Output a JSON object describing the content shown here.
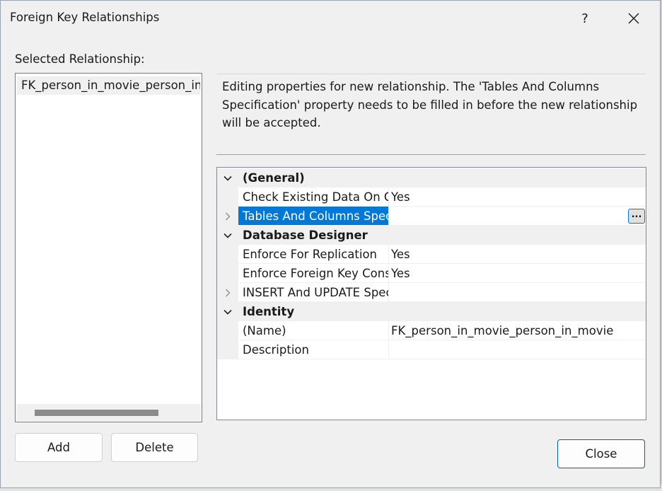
{
  "dialog": {
    "title": "Foreign Key Relationships",
    "help_label": "?",
    "close_icon": "close-x-icon"
  },
  "selected_relationship": {
    "label": "Selected Relationship:",
    "items": [
      "FK_person_in_movie_person_in_movie"
    ]
  },
  "description": "Editing properties for new relationship.  The 'Tables And Columns Specification' property needs to be filled in before the new relationship will be accepted.",
  "property_grid": {
    "categories": [
      {
        "name": "(General)",
        "expanded": true,
        "rows": [
          {
            "name": "Check Existing Data On Creation Or Re-Enabling",
            "value": "Yes",
            "expandable": false
          },
          {
            "name": "Tables And Columns Specification",
            "value": "",
            "expandable": true,
            "selected": true,
            "ellipsis": "..."
          }
        ]
      },
      {
        "name": "Database Designer",
        "expanded": true,
        "rows": [
          {
            "name": "Enforce For Replication",
            "value": "Yes",
            "expandable": false
          },
          {
            "name": "Enforce Foreign Key Constraint",
            "value": "Yes",
            "expandable": false
          },
          {
            "name": "INSERT And UPDATE Specification",
            "value": "",
            "expandable": true
          }
        ]
      },
      {
        "name": "Identity",
        "expanded": true,
        "rows": [
          {
            "name": "(Name)",
            "value": "FK_person_in_movie_person_in_movie",
            "expandable": false
          },
          {
            "name": "Description",
            "value": "",
            "expandable": false
          }
        ]
      }
    ]
  },
  "buttons": {
    "add": "Add",
    "delete": "Delete",
    "close": "Close"
  },
  "colors": {
    "selection": "#0078d7",
    "dialog_bg": "#f0f0f0"
  }
}
